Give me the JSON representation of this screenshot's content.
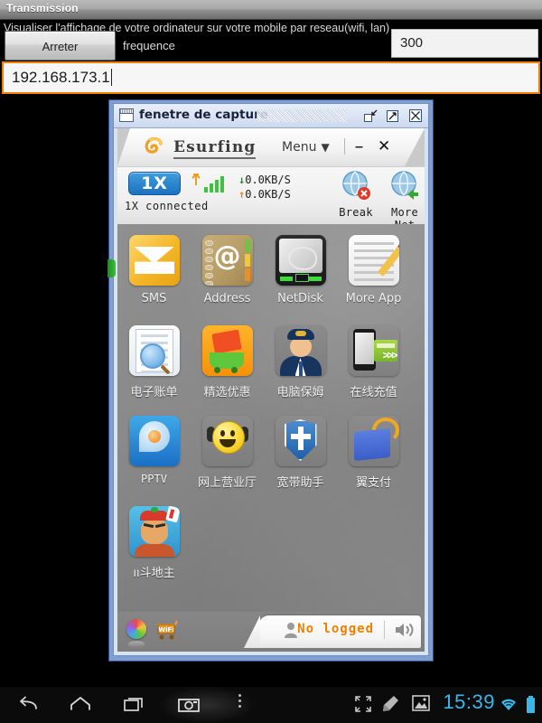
{
  "android_app": {
    "title": "Transmission",
    "description": "Visualiser l'affichage de votre ordinateur sur votre mobile par reseau(wifi, lan)",
    "stop_button_label": "Arreter",
    "frequency_label": "frequence",
    "frequency_value": "300",
    "frequency_placeholder": "300",
    "ip_value": "192.168.173.1",
    "ip_placeholder": "192.168.173.1"
  },
  "capture_window": {
    "title": "fenetre de capture",
    "buttons": {
      "restore": "restore-icon",
      "maximize": "maximize-icon",
      "close": "close-icon"
    }
  },
  "esurfing": {
    "brand": "Esurfing",
    "menu_label": "Menu",
    "minimize_label": "–",
    "close_label": "✕",
    "status": {
      "badge": "1X",
      "connection_text": "1X connected",
      "download_speed": "0.0KB/S",
      "upload_speed": "0.0KB/S",
      "down_arrow": "↓",
      "up_arrow": "↑",
      "break_label": "Break",
      "more_net_label": "More Net"
    },
    "apps": [
      [
        {
          "label": "SMS",
          "icon": "sms-icon",
          "script": "latin"
        },
        {
          "label": "Address",
          "icon": "address-book-icon",
          "script": "latin"
        },
        {
          "label": "NetDisk",
          "icon": "netdisk-icon",
          "script": "latin"
        },
        {
          "label": "More App",
          "icon": "more-app-icon",
          "script": "latin"
        }
      ],
      [
        {
          "label": "电子账单",
          "icon": "e-bill-icon",
          "script": "cjk"
        },
        {
          "label": "精选优惠",
          "icon": "promotions-icon",
          "script": "cjk"
        },
        {
          "label": "电脑保姆",
          "icon": "pc-nanny-icon",
          "script": "cjk"
        },
        {
          "label": "在线充值",
          "icon": "online-recharge-icon",
          "script": "cjk"
        }
      ],
      [
        {
          "label": "PPTV",
          "icon": "pptv-icon",
          "script": "mono"
        },
        {
          "label": "网上营业厅",
          "icon": "online-hall-icon",
          "script": "cjk"
        },
        {
          "label": "宽带助手",
          "icon": "broadband-assistant-icon",
          "script": "cjk"
        },
        {
          "label": "翼支付",
          "icon": "bestpay-icon",
          "script": "cjk"
        }
      ],
      [
        {
          "label": "ıı斗地主",
          "icon": "doudizhu-game-icon",
          "script": "cjk"
        }
      ]
    ],
    "footer": {
      "login_status": "No logged",
      "color_orb": "color-wheel-icon",
      "wifi_cart": "wifi-cart-icon",
      "speaker": "speaker-icon",
      "person": "person-icon"
    }
  },
  "navbar": {
    "back": "back-icon",
    "home": "home-icon",
    "recents": "recents-icon",
    "camera": "camera-icon",
    "overflow": "overflow-menu-icon",
    "expand": "expand-icon",
    "clean": "clean-icon",
    "gallery": "gallery-icon",
    "time": "15:39",
    "wifi": "wifi-icon",
    "battery": "battery-icon"
  },
  "colors": {
    "accent_orange": "#f08000",
    "window_blue": "#7f9fd2",
    "status_blue": "#1b72c0",
    "time_blue": "#3bb6e8"
  }
}
